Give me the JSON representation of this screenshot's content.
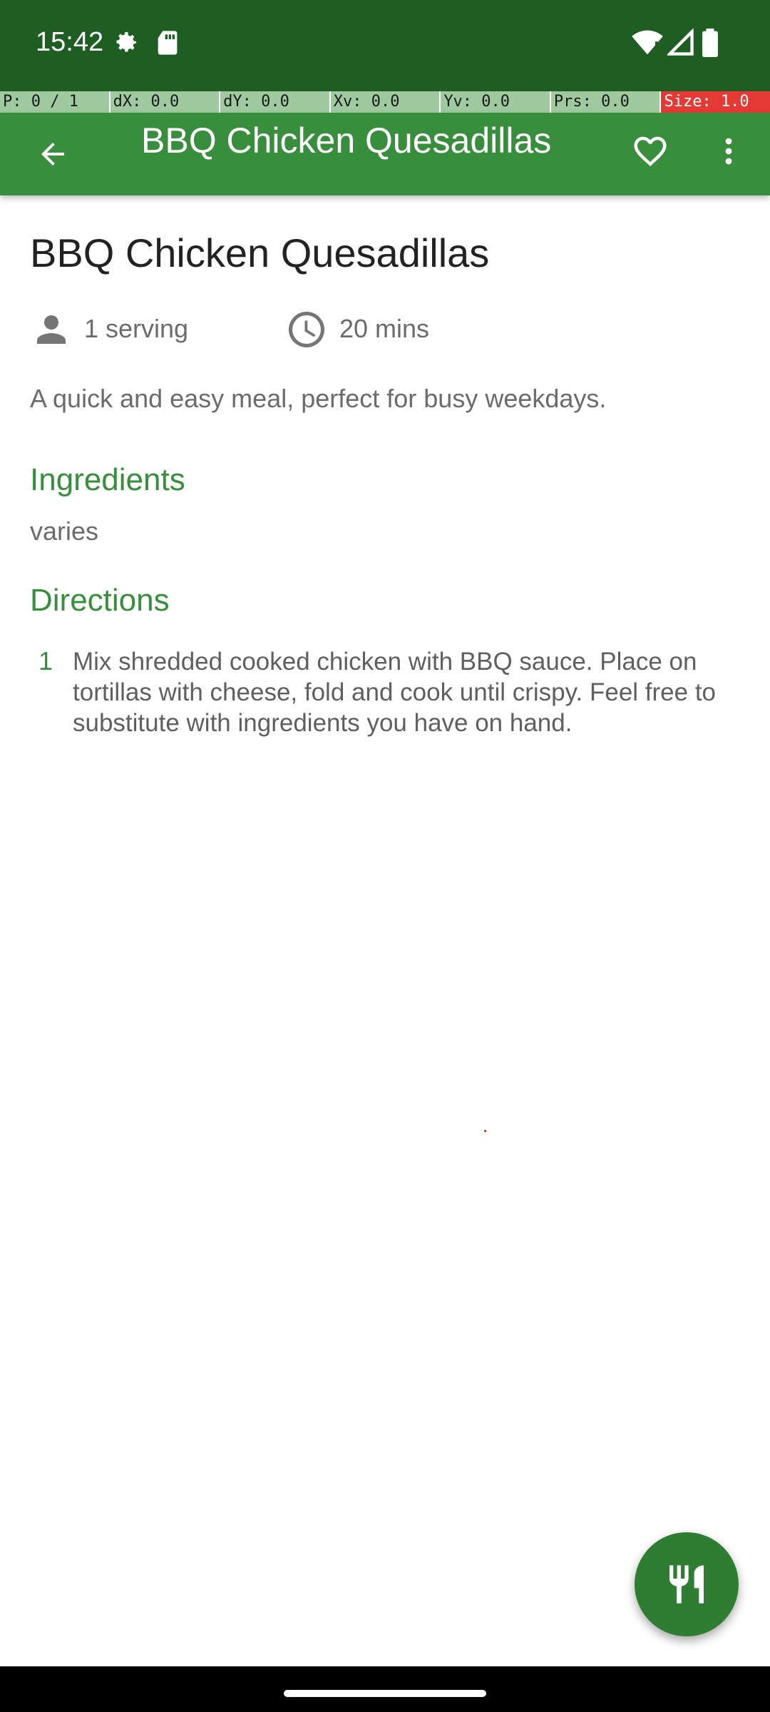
{
  "status_bar": {
    "time": "15:42",
    "icons": [
      "settings-icon",
      "sd-card-icon",
      "wifi-icon",
      "signal-icon",
      "battery-icon"
    ]
  },
  "pointer_overlay": {
    "p": "P: 0 / 1",
    "dx": "dX: 0.0",
    "dy": "dY: 0.0",
    "xv": "Xv: 0.0",
    "yv": "Yv: 0.0",
    "prs": "Prs: 0.0",
    "size": "Size: 1.0"
  },
  "app_bar": {
    "title": "BBQ Chicken Quesadillas",
    "back_icon": "arrow-back-icon",
    "favorite_icon": "heart-outline-icon",
    "more_icon": "more-vert-icon"
  },
  "recipe": {
    "title": "BBQ Chicken Quesadillas",
    "servings": "1 serving",
    "time": "20 mins",
    "description": "A quick and easy meal, perfect for busy weekdays.",
    "ingredients_heading": "Ingredients",
    "ingredients": [
      "varies"
    ],
    "directions_heading": "Directions",
    "directions": [
      {
        "number": "1",
        "text": "Mix shredded cooked chicken with BBQ sauce. Place on tortillas with cheese, fold and cook until crispy. Feel free to substitute with ingredients you have on hand."
      }
    ]
  },
  "fab": {
    "icon": "restaurant-icon"
  },
  "colors": {
    "status_bar": "#1e5e23",
    "app_bar": "#388e3c",
    "accent": "#388e3c",
    "fab": "#2e7d32"
  }
}
